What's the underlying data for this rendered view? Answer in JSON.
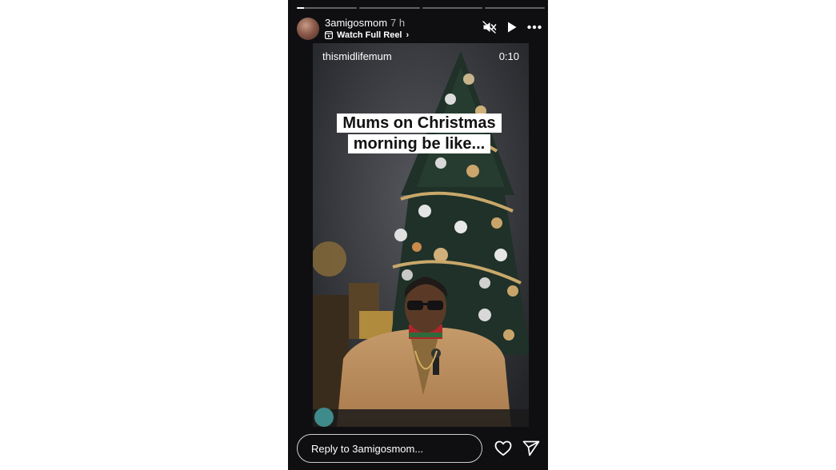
{
  "story": {
    "progress_segments": [
      0.12,
      0,
      0,
      0
    ],
    "username": "3amigosmom",
    "age": "7 h",
    "reel_link_label": "Watch Full Reel",
    "icons": [
      "muted-speaker-icon",
      "play-icon",
      "more-icon",
      "reel-icon",
      "chevron-right-icon"
    ]
  },
  "video": {
    "author": "thismidlifemum",
    "duration": "0:10",
    "caption_lines": [
      "Mums on Christmas",
      "morning be like..."
    ]
  },
  "footer": {
    "reply_placeholder": "Reply to 3amigosmom...",
    "icons": [
      "heart-icon",
      "send-icon"
    ]
  }
}
